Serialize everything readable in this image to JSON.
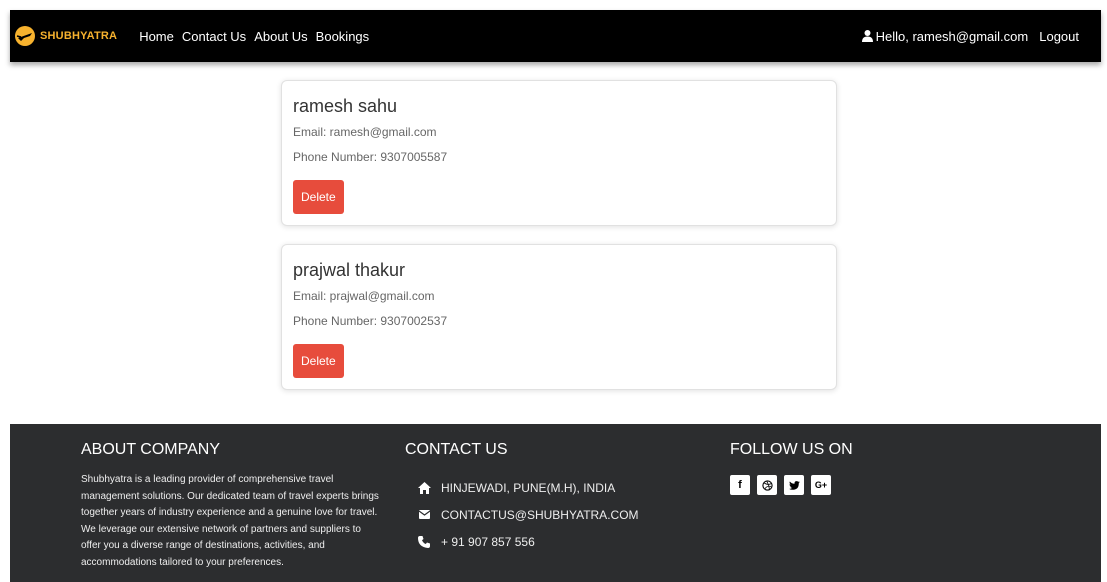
{
  "nav": {
    "brand": "SHUBHYATRA",
    "links": [
      "Home",
      "Contact Us",
      "About Us",
      "Bookings"
    ],
    "greeting": "Hello, ramesh@gmail.com",
    "logout": "Logout"
  },
  "users": [
    {
      "name": "ramesh sahu",
      "email": "Email: ramesh@gmail.com",
      "phone": "Phone Number: 9307005587",
      "delete_label": "Delete"
    },
    {
      "name": "prajwal thakur",
      "email": "Email: prajwal@gmail.com",
      "phone": "Phone Number: 9307002537",
      "delete_label": "Delete"
    }
  ],
  "footer": {
    "about_title": "ABOUT COMPANY",
    "about_text": "Shubhyatra is a leading provider of comprehensive travel management solutions. Our dedicated team of travel experts brings together years of industry experience and a genuine love for travel. We leverage our extensive network of partners and suppliers to offer you a diverse range of destinations, activities, and accommodations tailored to your preferences.",
    "contact_title": "CONTACT US",
    "address": "HINJEWADI, PUNE(M.H), INDIA",
    "email": "CONTACTUS@SHUBHYATRA.COM",
    "phone": "+ 91 907 857 556",
    "follow_title": "FOLLOW US ON",
    "socials": [
      {
        "icon": "facebook-icon",
        "glyph": "f"
      },
      {
        "icon": "dribbble-icon",
        "glyph": "⊛"
      },
      {
        "icon": "twitter-icon",
        "glyph": "🐦"
      },
      {
        "icon": "google-plus-icon",
        "glyph": "G+"
      }
    ]
  },
  "colors": {
    "navbar_bg": "#000000",
    "brand": "#f7b22e",
    "delete_button": "#e74c3c",
    "footer_bg": "#2c2d2f"
  }
}
